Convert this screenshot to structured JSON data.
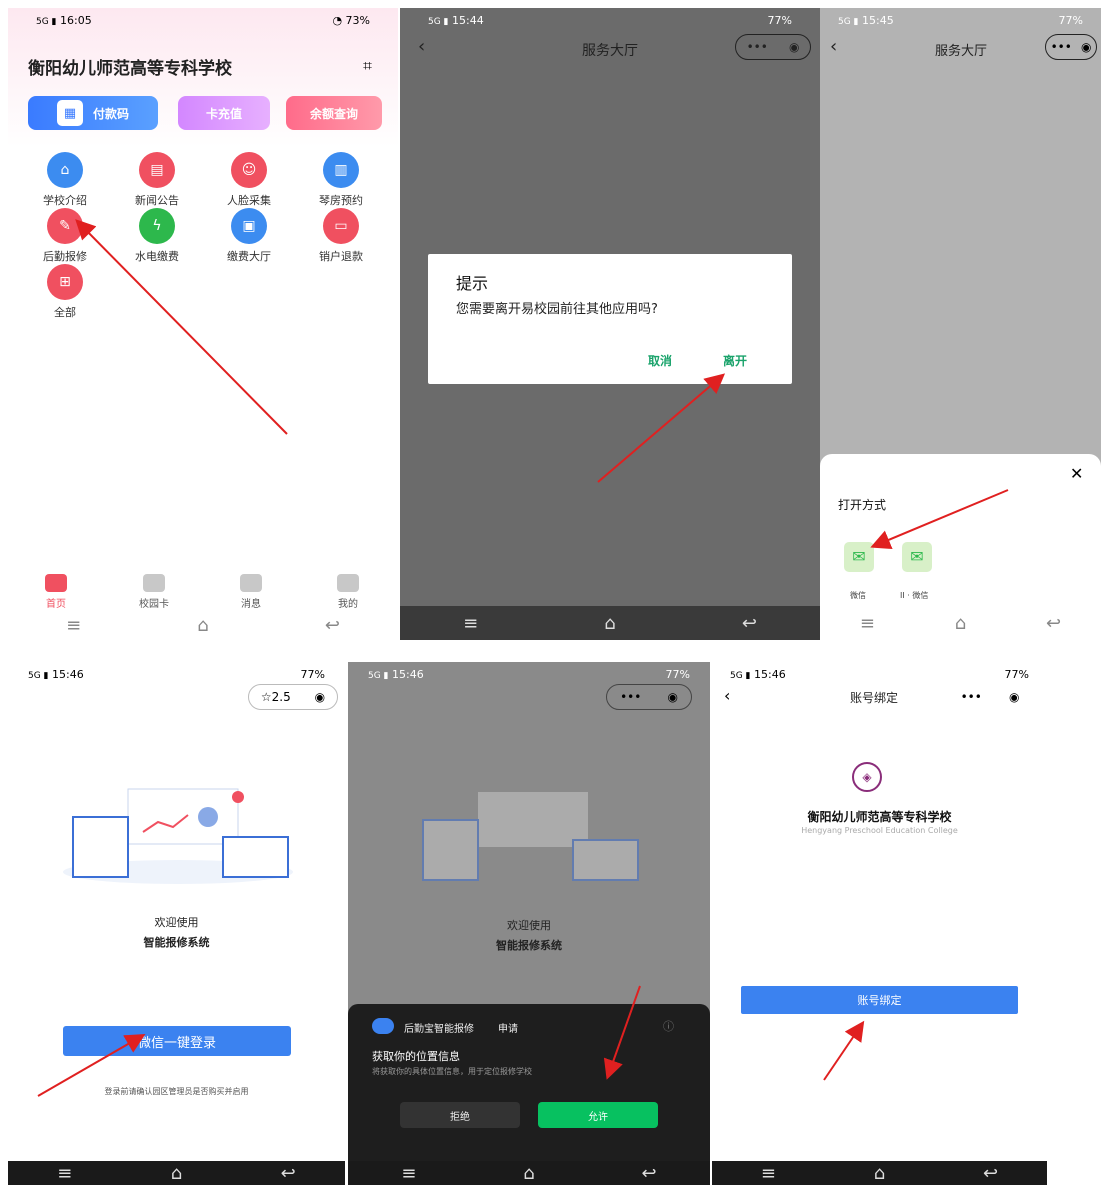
{
  "p1": {
    "time": "16:05",
    "battery": "73%",
    "title": "衡阳幼儿师范高等专科学校",
    "buttons": [
      "付款码",
      "卡充值",
      "余额查询"
    ],
    "grid": [
      "学校介绍",
      "新闻公告",
      "人脸采集",
      "琴房预约",
      "后勤报修",
      "水电缴费",
      "缴费大厅",
      "销户退款",
      "全部"
    ],
    "tabs": [
      "首页",
      "校园卡",
      "消息",
      "我的"
    ]
  },
  "p2": {
    "time": "15:44",
    "battery": "77%",
    "title": "服务大厅",
    "dialog_title": "提示",
    "dialog_text": "您需要离开易校园前往其他应用吗?",
    "cancel": "取消",
    "leave": "离开"
  },
  "p3": {
    "time": "15:45",
    "battery": "77%",
    "title": "服务大厅",
    "sheet_title": "打开方式",
    "app1": "微信",
    "app2": "II · 微信"
  },
  "p4": {
    "time": "15:46",
    "battery": "77%",
    "rating": "2.5",
    "welcome": "欢迎使用",
    "system": "智能报修系统",
    "login": "微信一键登录",
    "note": "登录前请确认园区管理员是否购买并启用"
  },
  "p5": {
    "time": "15:46",
    "battery": "77%",
    "welcome": "欢迎使用",
    "system": "智能报修系统",
    "app_name": "后勤宝智能报修",
    "apply": "申请",
    "perm_title": "获取你的位置信息",
    "perm_desc": "将获取你的具体位置信息，用于定位报修学校",
    "deny": "拒绝",
    "allow": "允许"
  },
  "p6": {
    "time": "15:46",
    "battery": "77%",
    "title": "账号绑定",
    "school": "衡阳幼儿师范高等专科学校",
    "school_en": "Hengyang Preschool Education College",
    "bind": "账号绑定"
  }
}
